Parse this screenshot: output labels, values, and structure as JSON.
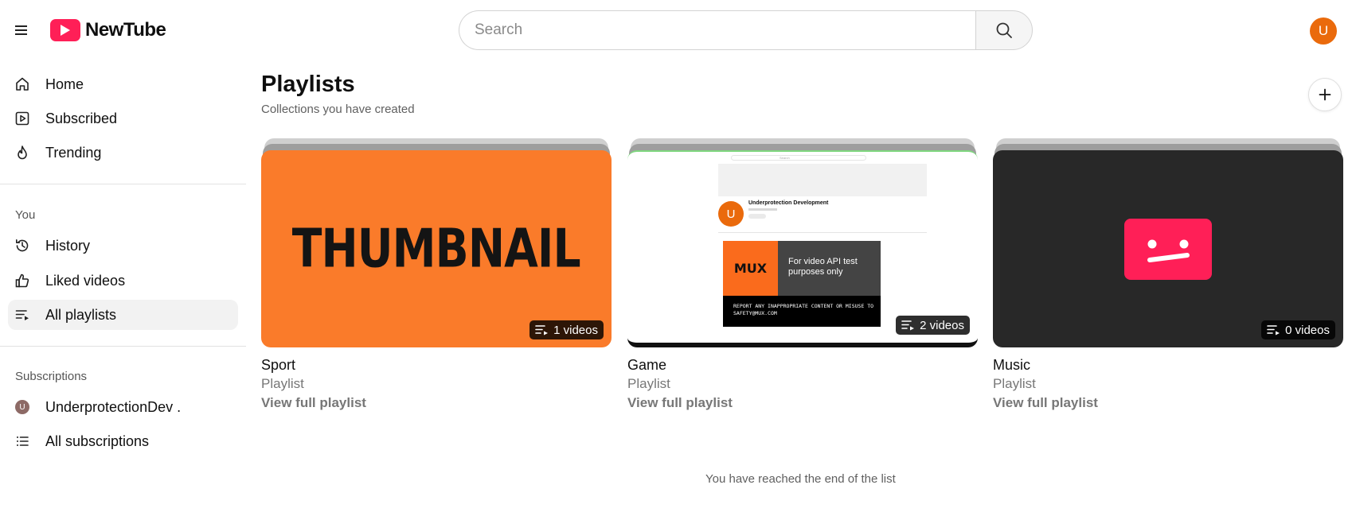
{
  "header": {
    "logo_text": "NewTube",
    "search_placeholder": "Search",
    "avatar_letter": "U",
    "brand_color": "#ff1f57",
    "avatar_color": "#ea6a0c"
  },
  "sidebar": {
    "main_items": [
      {
        "label": "Home",
        "icon": "home-icon"
      },
      {
        "label": "Subscribed",
        "icon": "play-square-icon"
      },
      {
        "label": "Trending",
        "icon": "flame-icon"
      }
    ],
    "you_title": "You",
    "you_items": [
      {
        "label": "History",
        "icon": "history-icon"
      },
      {
        "label": "Liked videos",
        "icon": "thumbs-up-icon"
      },
      {
        "label": "All playlists",
        "icon": "playlist-icon",
        "active": true
      }
    ],
    "subscriptions_title": "Subscriptions",
    "subscription_items": [
      {
        "label": "UnderprotectionDev .",
        "avatar_letter": "U"
      },
      {
        "label": "All subscriptions",
        "icon": "list-icon"
      }
    ]
  },
  "main": {
    "title": "Playlists",
    "subtitle": "Collections you have created",
    "end_note": "You have reached the end of the list",
    "playlists": [
      {
        "title": "Sport",
        "type": "Playlist",
        "link": "View full playlist",
        "count": "1 videos",
        "thumb_text": "THUMBNAIL"
      },
      {
        "title": "Game",
        "type": "Playlist",
        "link": "View full playlist",
        "count": "2 videos",
        "thumb": {
          "search": "Search",
          "channel": "Underprotection Development",
          "channel_letter": "U",
          "mux_logo": "MUX",
          "mux_message": "For video API test purposes only",
          "mux_report": "REPORT ANY INAPPROPRIATE CONTENT OR MISUSE TO SAFETY@MUX.COM"
        }
      },
      {
        "title": "Music",
        "type": "Playlist",
        "link": "View full playlist",
        "count": "0 videos"
      }
    ]
  }
}
